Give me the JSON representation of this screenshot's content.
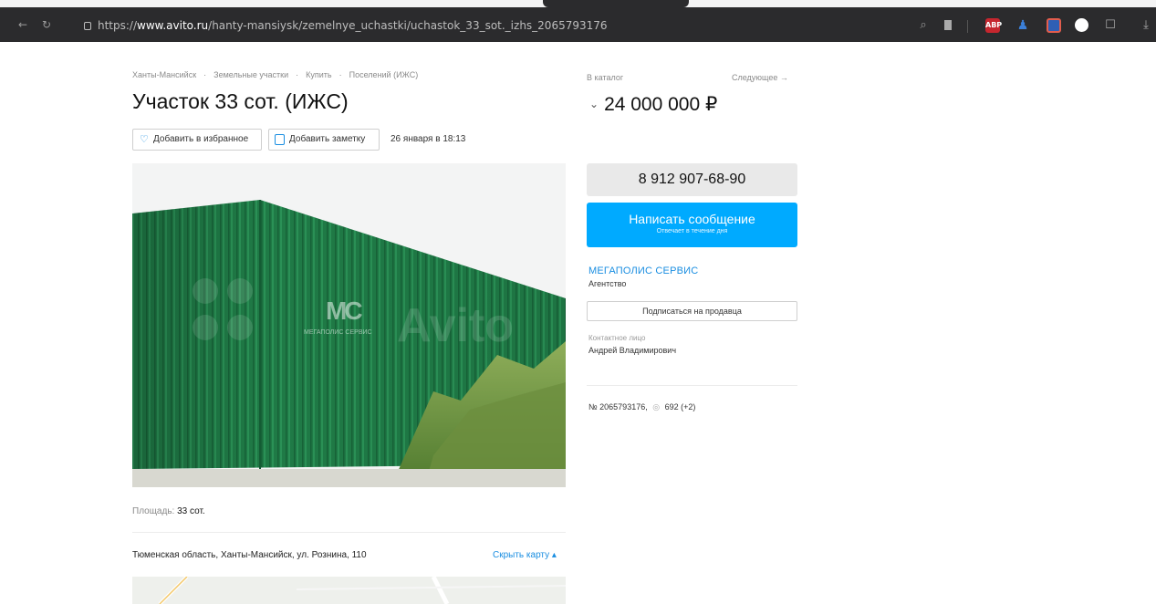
{
  "browser": {
    "url_prefix": "https://",
    "url_host": "www.avito.ru",
    "url_path": "/hanty-mansiysk/zemelnye_uchastki/uchastok_33_sot._izhs_2065793176",
    "ext_abp": "ABP"
  },
  "breadcrumbs": [
    "Ханты-Мансийск",
    "·",
    "Земельные участки",
    "·",
    "Купить",
    "·",
    "Поселений (ИЖС)"
  ],
  "listing": {
    "title": "Участок 33 сот. (ИЖС)",
    "fav_label": "Добавить в избранное",
    "note_label": "Добавить заметку",
    "date": "26 января в 18:13",
    "area_label": "Площадь:",
    "area_value": "33 сот.",
    "address": "Тюменская область, Ханты-Мансийск, ул. Рознина, 110",
    "hide_map": "Скрыть карту ▴"
  },
  "photo": {
    "watermark_logo": "MC",
    "watermark_company": "МЕГАПОЛИС СЕРВИС",
    "watermark_brand": "Avito"
  },
  "sidebar": {
    "catalog_link": "В каталог",
    "next_link": "Следующее →",
    "price": "24 000 000 ₽",
    "phone": "8 912 907-68-90",
    "message_title": "Написать сообщение",
    "message_sub": "Отвечает в течение дня",
    "seller_name": "МЕГАПОЛИС СЕРВИС",
    "seller_type": "Агентство",
    "subscribe": "Подписаться на продавца",
    "contact_label": "Контактное лицо",
    "contact_name": "Андрей Владимирович",
    "ad_number": "№ 2065793176,",
    "views": "692 (+2)"
  },
  "colors": {
    "accent": "#00aaff",
    "link": "#1a8ee1",
    "fence": "#1f7a46"
  }
}
